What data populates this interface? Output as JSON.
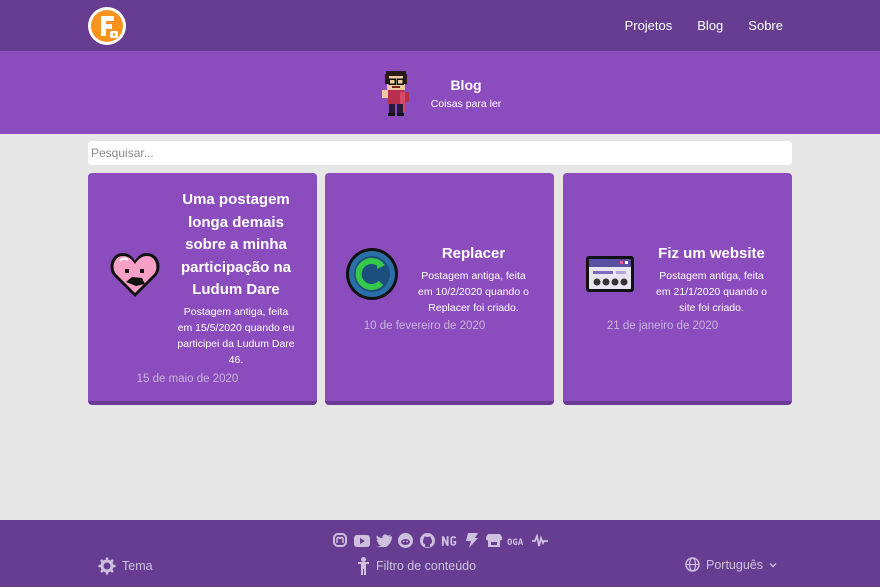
{
  "nav": {
    "items": [
      {
        "label": "Projetos"
      },
      {
        "label": "Blog"
      },
      {
        "label": "Sobre"
      }
    ]
  },
  "header": {
    "title": "Blog",
    "subtitle": "Coisas para ler"
  },
  "search": {
    "placeholder": "Pesquisar..."
  },
  "posts": [
    {
      "title": "Uma postagem longa demais sobre a minha participação na Ludum Dare",
      "description": "Postagem antiga, feita em 15/5/2020 quando eu participei da Ludum Dare 46.",
      "date": "15 de maio de 2020",
      "icon": "heart-icon"
    },
    {
      "title": "Replacer",
      "description": "Postagem antiga, feita em 10/2/2020 quando o Replacer foi criado.",
      "date": "10 de fevereiro de 2020",
      "icon": "replacer-icon"
    },
    {
      "title": "Fiz um website",
      "description": "Postagem antiga, feita em 21/1/2020 quando o site foi criado.",
      "date": "21 de janeiro de 2020",
      "icon": "website-icon"
    }
  ],
  "footer": {
    "theme_label": "Tema",
    "filter_label": "Filtro de conteúdo",
    "language_label": "Português",
    "social_icons": [
      "mastodon-icon",
      "youtube-icon",
      "twitter-icon",
      "reddit-icon",
      "github-icon",
      "newgrounds-icon",
      "gamejolt-icon",
      "itch-icon",
      "oga-icon",
      "soundcloud-icon"
    ]
  },
  "colors": {
    "topbar": "#663d91",
    "header": "#8b4cbd",
    "background": "#e6e6e6",
    "card": "#8b4cbd"
  }
}
